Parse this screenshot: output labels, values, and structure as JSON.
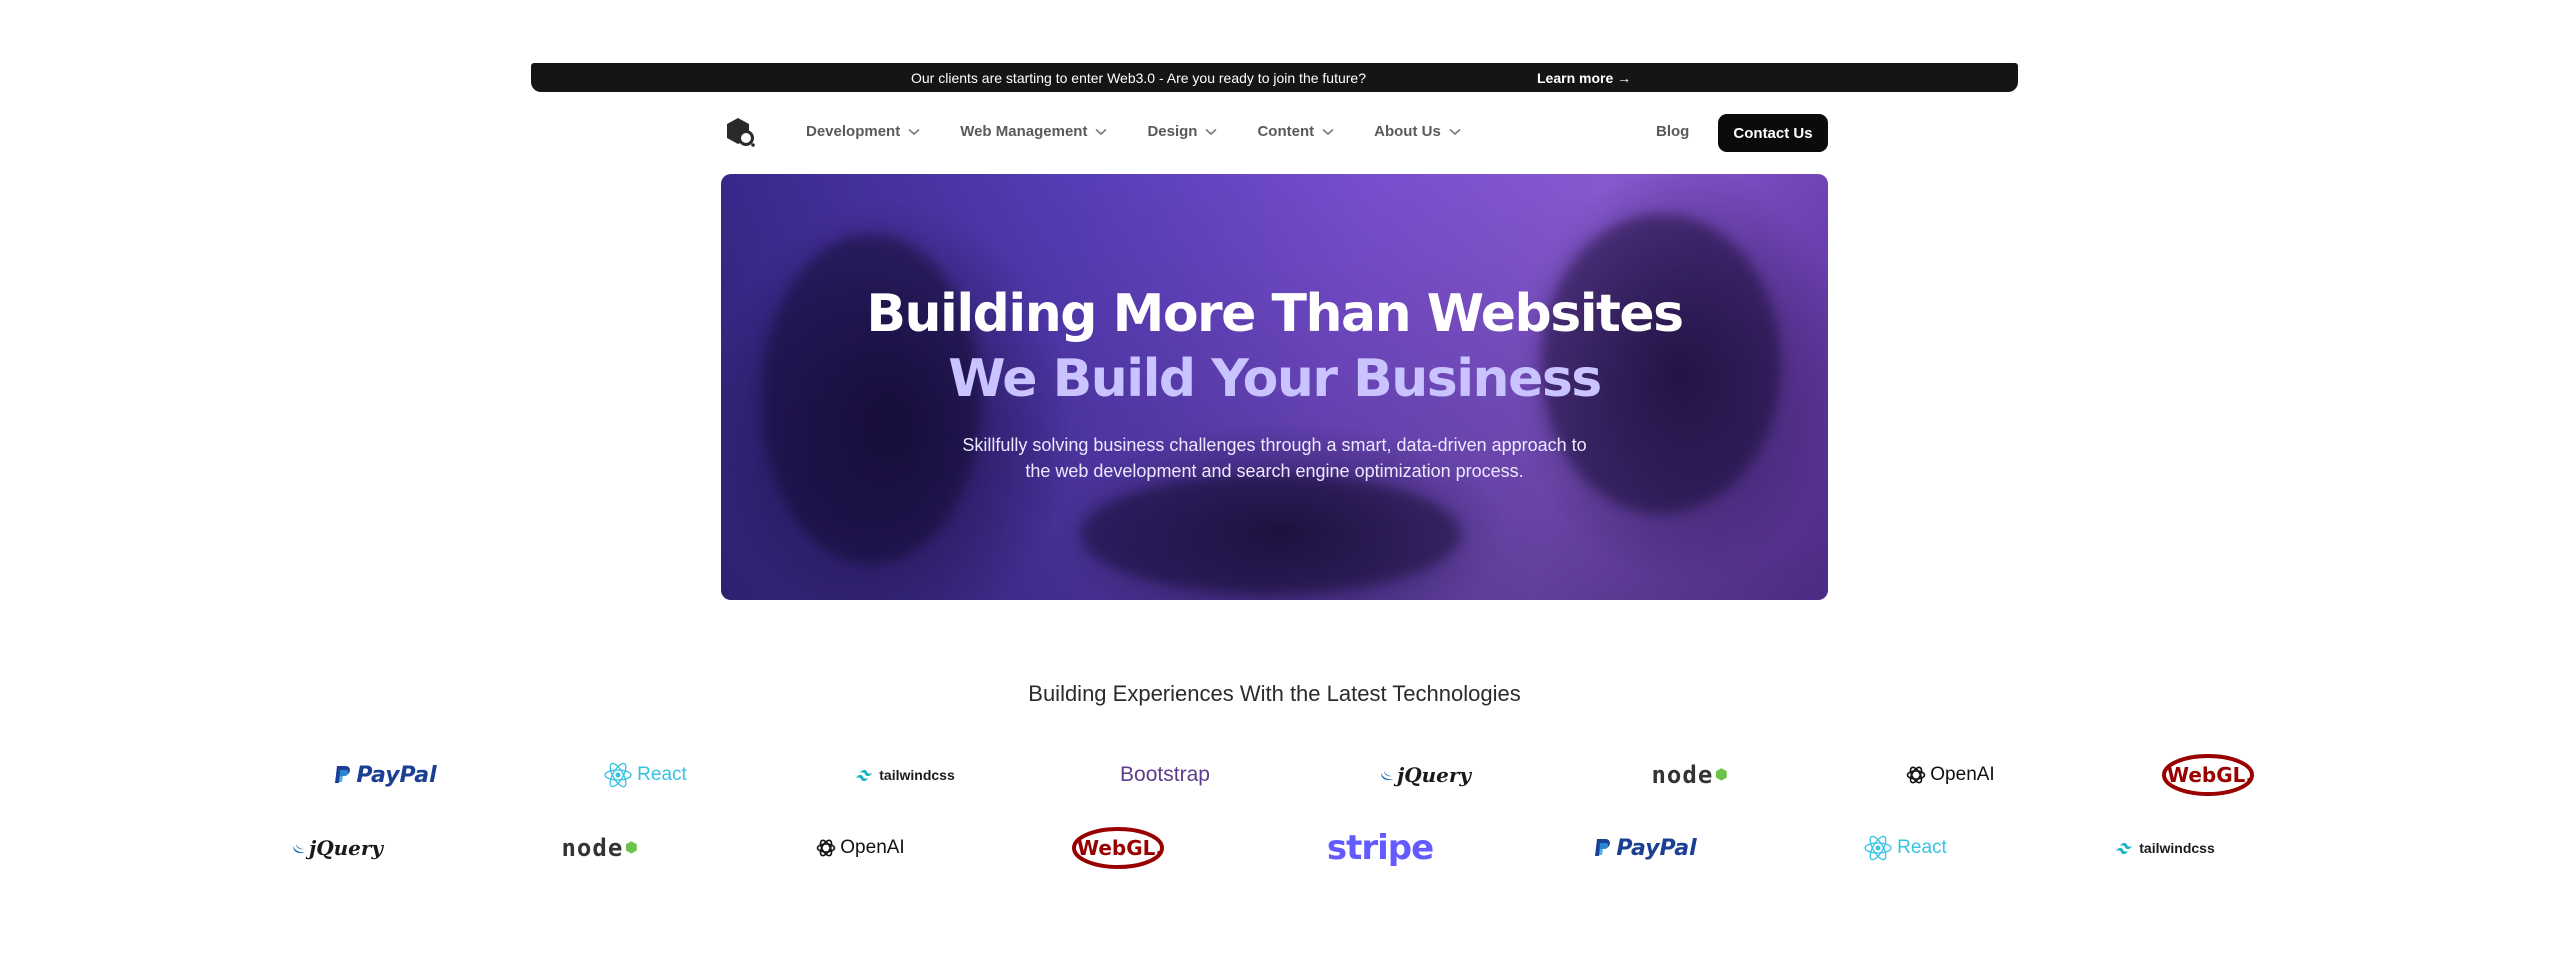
{
  "announcement": {
    "message": "Our clients are starting to enter Web3.0 - Are you ready to join the future?",
    "link": "Learn more →"
  },
  "nav": {
    "logo_icon": "hexagon-logo-icon",
    "menu": [
      {
        "label": "Development"
      },
      {
        "label": "Web Management"
      },
      {
        "label": "Design"
      },
      {
        "label": "Content"
      },
      {
        "label": "About Us"
      }
    ],
    "blog": "Blog",
    "contact": "Contact Us"
  },
  "hero": {
    "title_line1": "Building More Than Websites",
    "title_line2": "We Build Your Business",
    "subtitle_line1": "Skillfully solving business challenges through a smart, data-driven approach to",
    "subtitle_line2": "the web development and search engine optimization process."
  },
  "technologies": {
    "title": "Building Experiences With the Latest Technologies",
    "row1": [
      "PayPal",
      "React",
      "tailwindcss",
      "Bootstrap",
      "jQuery",
      "node",
      "OpenAI",
      "WebGL."
    ],
    "row2": [
      "jQuery",
      "node",
      "OpenAI",
      "WebGL.",
      "stripe",
      "PayPal",
      "React",
      "tailwindcss"
    ]
  },
  "colors": {
    "announcement_bg": "#151515",
    "contact_bg": "#0b0b0b",
    "hero_accent": "#7d52d8",
    "hero_title2": "#c9c4ff"
  }
}
